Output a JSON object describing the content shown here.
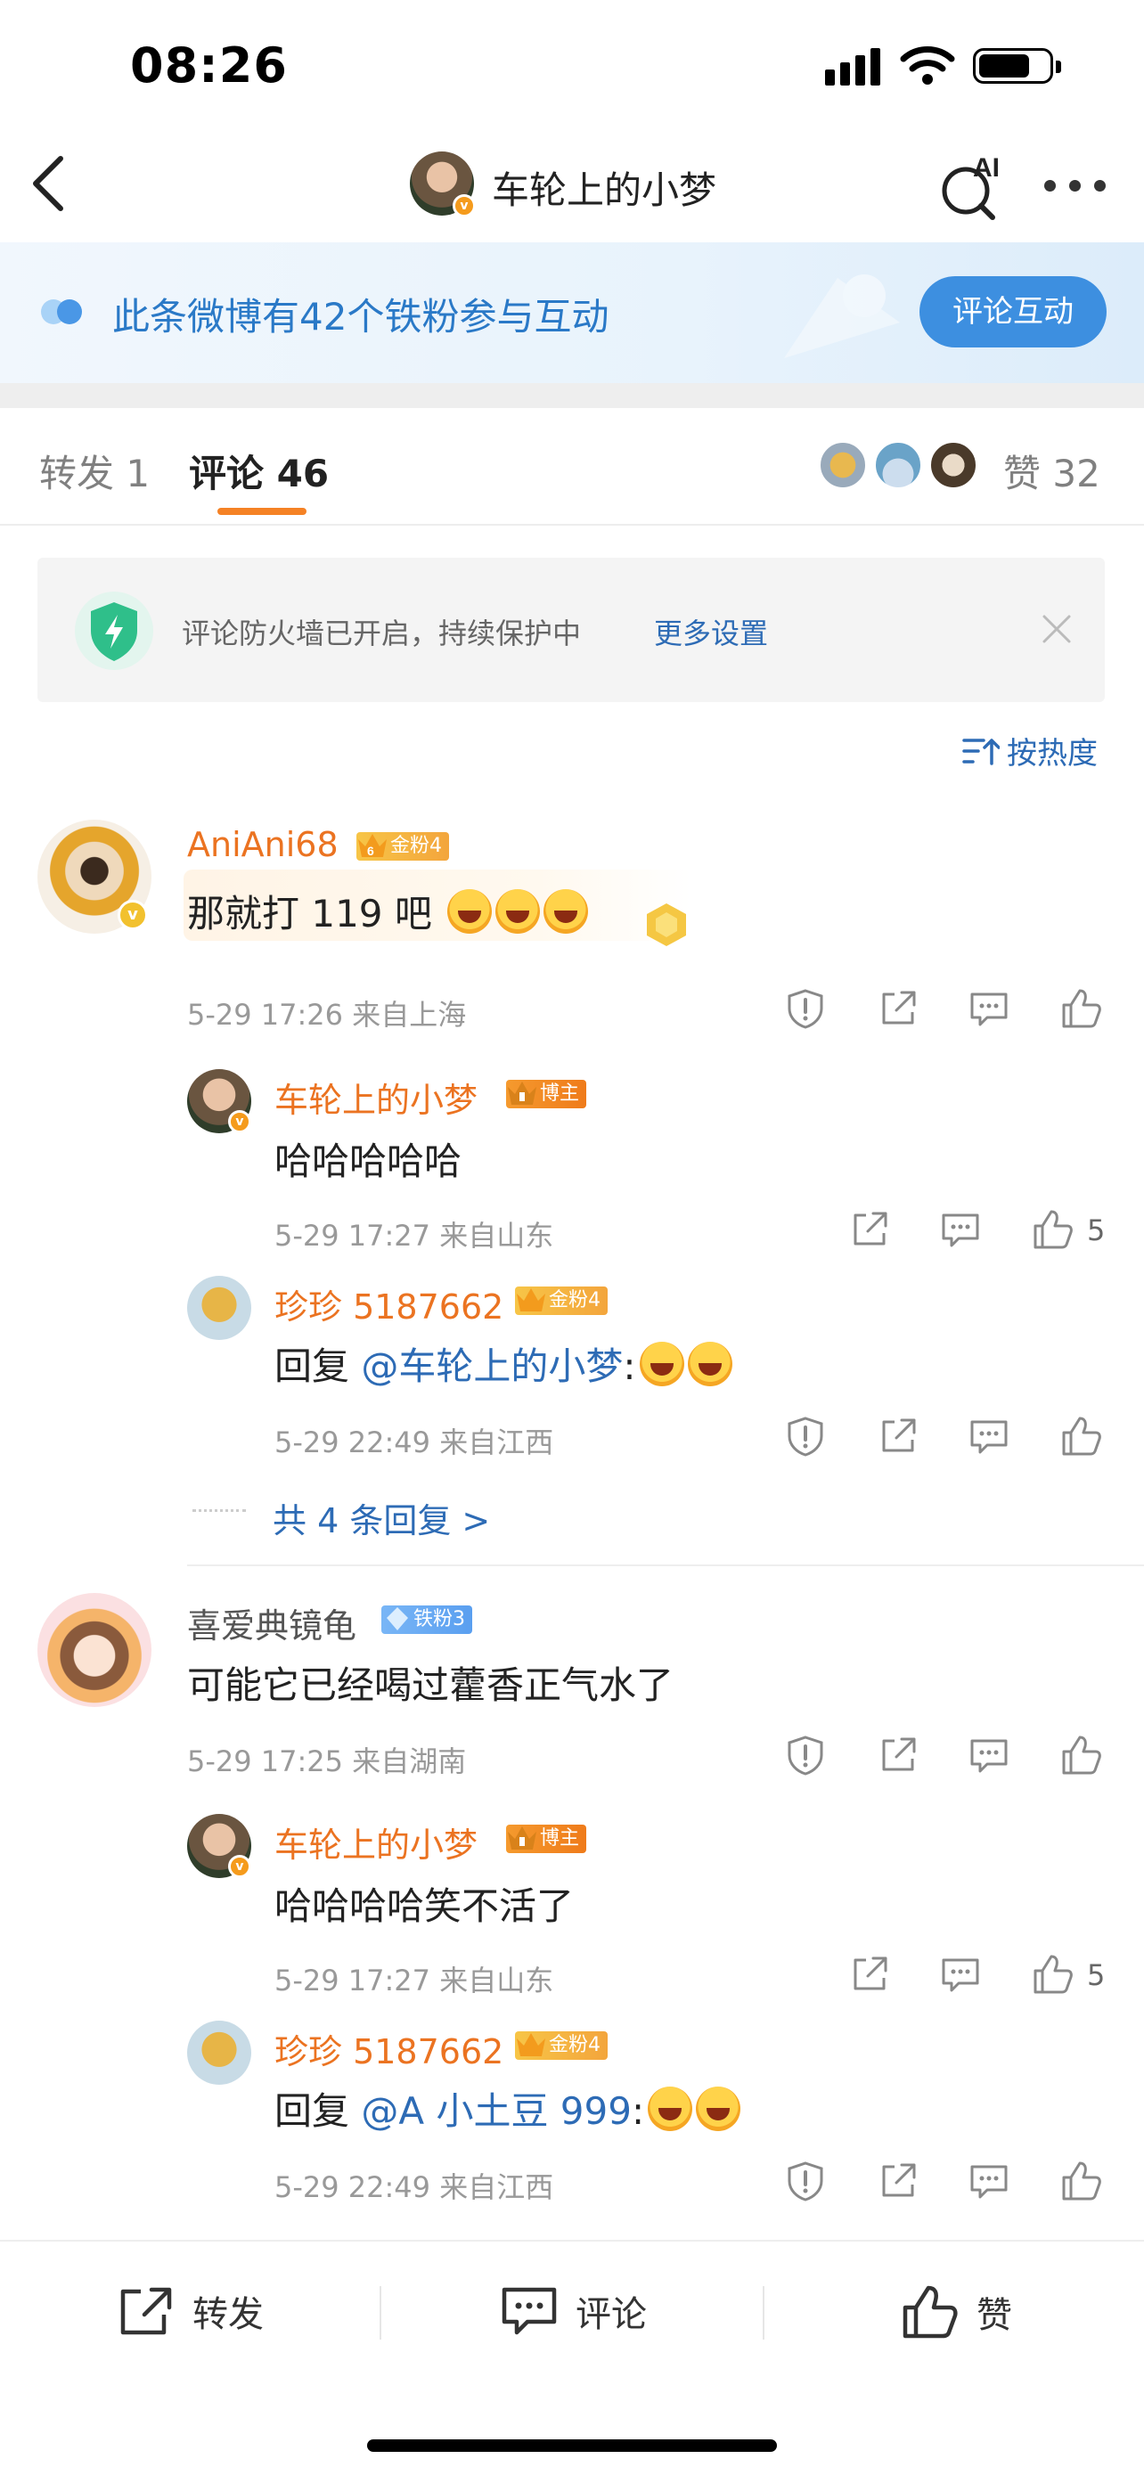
{
  "status_bar": {
    "time": "08:26"
  },
  "nav": {
    "title": "车轮上的小梦",
    "ai_label": "AI"
  },
  "banner": {
    "text": "此条微博有42个铁粉参与互动",
    "button": "评论互动"
  },
  "tabs": {
    "repost": "转发 1",
    "comment": "评论 46",
    "likes": "赞 32"
  },
  "firewall": {
    "text": "评论防火墙已开启，持续保护中",
    "link": "更多设置"
  },
  "sort": {
    "label": "按热度"
  },
  "comments": [
    {
      "user": "AniAni68",
      "badge": "金粉4",
      "badge_level": "6",
      "text": "那就打 119 吧",
      "meta": "5-29 17:26 来自上海",
      "replies": [
        {
          "user": "车轮上的小梦",
          "badge": "博主",
          "text": "哈哈哈哈哈",
          "meta": "5-29 17:27 来自山东",
          "likes": "5"
        },
        {
          "user": "珍珍 5187662",
          "badge": "金粉4",
          "reply_prefix": "回复 ",
          "mention": "@车轮上的小梦",
          "suffix": ":",
          "meta": "5-29 22:49 来自江西"
        }
      ],
      "more_replies": "共 4 条回复 >"
    },
    {
      "user": "喜爱典镜龟",
      "badge": "铁粉3",
      "text": "可能它已经喝过藿香正气水了",
      "meta": "5-29 17:25 来自湖南",
      "replies": [
        {
          "user": "车轮上的小梦",
          "badge": "博主",
          "text": "哈哈哈哈笑不活了",
          "meta": "5-29 17:27 来自山东",
          "likes": "5"
        },
        {
          "user": "珍珍 5187662",
          "badge": "金粉4",
          "reply_prefix": "回复 ",
          "mention": "@A 小土豆 999",
          "suffix": ":",
          "meta": "5-29 22:49 来自江西"
        }
      ]
    }
  ],
  "bottom_bar": {
    "repost": "转发",
    "comment": "评论",
    "like": "赞"
  },
  "icons": [
    "back-icon",
    "ai-search-icon",
    "more-icon",
    "interaction-icon",
    "shield-icon",
    "close-icon",
    "sort-icon",
    "report-icon",
    "share-icon",
    "comment-icon",
    "like-icon"
  ],
  "colors": {
    "accent": "#f58225",
    "link": "#2d6bb5",
    "username": "#eb7321",
    "button_blue": "#3d8fe0"
  }
}
